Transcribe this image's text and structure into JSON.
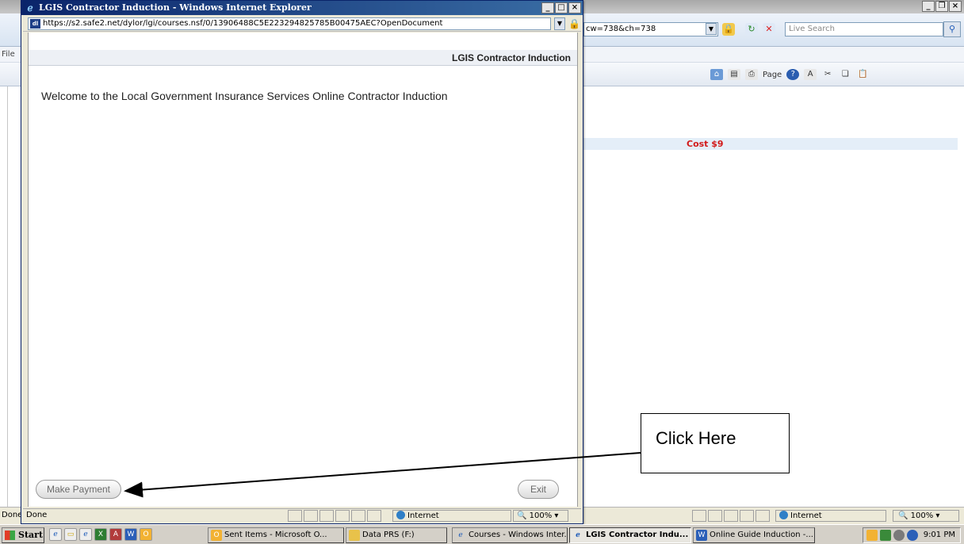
{
  "background_window": {
    "address_fragment": "cw=738&ch=738",
    "search_placeholder": "Live Search",
    "menu_fragment": "File",
    "page_menu": "Page",
    "cost_label": "Cost $9",
    "status_text": "Done",
    "status_zone": "Internet",
    "status_zoom": "100%"
  },
  "popup": {
    "title": "LGIS Contractor Induction - Windows Internet Explorer",
    "address": "https://s2.safe2.net/dylor/lgi/courses.nsf/0/13906488C5E223294825785B00475AEC?OpenDocument",
    "page_header": "LGIS Contractor Induction",
    "welcome_text": "Welcome to the Local Government Insurance Services Online Contractor Induction",
    "make_payment_label": "Make Payment",
    "exit_label": "Exit",
    "status_text": "Done",
    "status_zone": "Internet",
    "status_zoom": "100%"
  },
  "annotation": {
    "callout_text": "Click Here"
  },
  "taskbar": {
    "start_label": "Start",
    "tasks": [
      {
        "label": "Sent Items - Microsoft O..."
      },
      {
        "label": "Data PRS (F:)"
      },
      {
        "label": "Courses - Windows Inter..."
      },
      {
        "label": "LGIS Contractor Indu..."
      },
      {
        "label": "Online  Guide Induction -..."
      }
    ],
    "clock": "9:01 PM"
  },
  "colors": {
    "title_gradient_start": "#0a246a",
    "cost_red": "#d21a1a",
    "taskbar": "#d4d0c8"
  }
}
